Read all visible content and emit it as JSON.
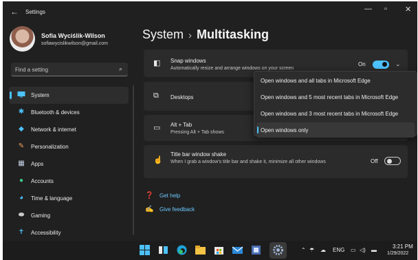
{
  "window": {
    "title": "Settings",
    "back_icon": "arrow-left-icon",
    "minimize_glyph": "—",
    "maximize_glyph": "▫",
    "close_glyph": "✕"
  },
  "profile": {
    "name": "Sofia Wyciślik-Wilson",
    "email": "sofiawycislikwilson@gmail.com"
  },
  "search": {
    "placeholder": "Find a setting",
    "icon": "search-icon"
  },
  "sidebar": {
    "items": [
      {
        "label": "System",
        "icon": "monitor-icon",
        "active": true
      },
      {
        "label": "Bluetooth & devices",
        "icon": "bluetooth-icon"
      },
      {
        "label": "Network & internet",
        "icon": "wifi-icon"
      },
      {
        "label": "Personalization",
        "icon": "brush-icon"
      },
      {
        "label": "Apps",
        "icon": "apps-icon"
      },
      {
        "label": "Accounts",
        "icon": "person-icon"
      },
      {
        "label": "Time & language",
        "icon": "globe-clock-icon"
      },
      {
        "label": "Gaming",
        "icon": "gamepad-icon"
      },
      {
        "label": "Accessibility",
        "icon": "accessibility-icon"
      }
    ]
  },
  "header": {
    "parent": "System",
    "separator": "›",
    "current": "Multitasking"
  },
  "settings": {
    "snap": {
      "title": "Snap windows",
      "desc": "Automatically resize and arrange windows on your screen",
      "state": "On",
      "icon": "snap-layout-icon"
    },
    "desktops": {
      "title": "Desktops",
      "icon": "desktops-icon"
    },
    "alttab": {
      "title": "Alt + Tab",
      "desc": "Pressing Alt + Tab shows",
      "icon": "alt-tab-icon"
    },
    "shake": {
      "title": "Title bar window shake",
      "desc": "When I grab a window's title bar and shake it, minimize all other windows",
      "state": "Off",
      "icon": "window-shake-icon"
    }
  },
  "dropdown": {
    "options": [
      "Open windows and all tabs in Microsoft Edge",
      "Open windows and 5 most recent tabs in Microsoft Edge",
      "Open windows and 3 most recent tabs in Microsoft Edge",
      "Open windows only"
    ],
    "selected": "Open windows only"
  },
  "links": {
    "help": "Get help",
    "feedback": "Give feedback"
  },
  "taskbar": {
    "language": "ENG",
    "time": "3:21 PM",
    "date": "1/29/2022",
    "icons": [
      "start-icon",
      "task-view-icon",
      "edge-icon",
      "file-explorer-icon",
      "store-icon",
      "mail-icon",
      "app-icon",
      "settings-icon"
    ]
  },
  "colors": {
    "accent": "#4cc2ff",
    "background": "#202020",
    "card": "#2b2b2b"
  }
}
